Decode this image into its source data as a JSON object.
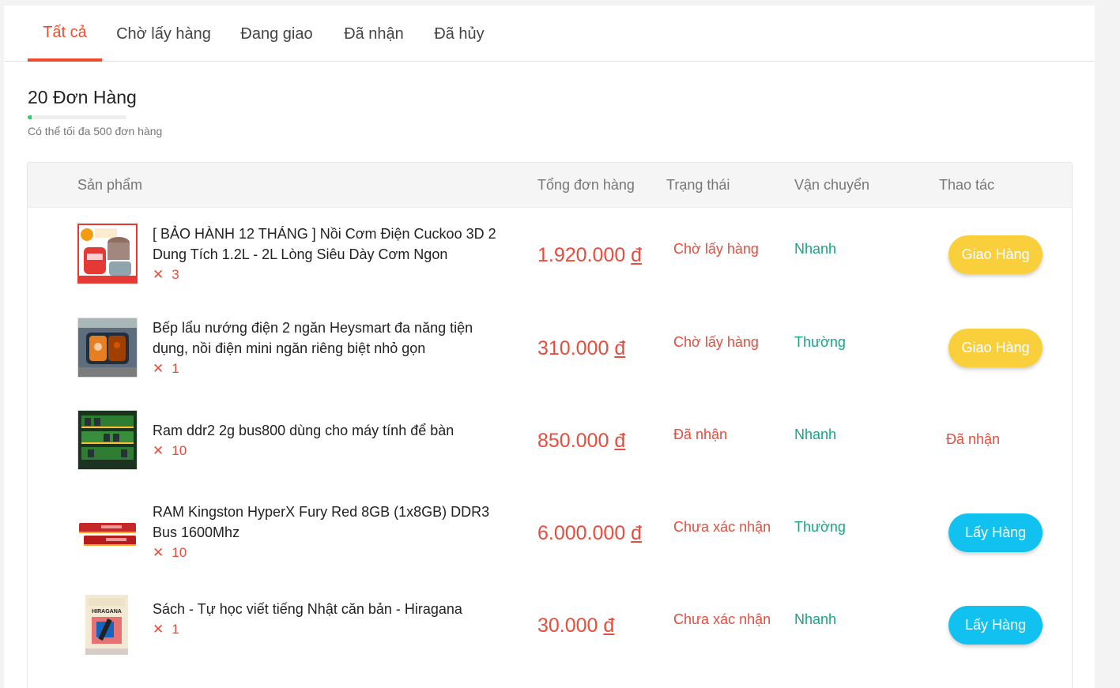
{
  "tabs": [
    {
      "label": "Tất cả"
    },
    {
      "label": "Chờ lấy hàng"
    },
    {
      "label": "Đang giao"
    },
    {
      "label": "Đã nhận"
    },
    {
      "label": "Đã hủy"
    }
  ],
  "summary": {
    "title": "20 Đơn Hàng",
    "subtitle": "Có thể tối đa 500 đơn hàng",
    "progress_fraction": 0.04
  },
  "table": {
    "headers": {
      "product": "Sản phẩm",
      "total": "Tổng đơn hàng",
      "status": "Trạng thái",
      "shipping": "Vận chuyển",
      "action": "Thao tác"
    },
    "rows": [
      {
        "name": "[ BẢO HÀNH 12 THÁNG ] Nồi Cơm Điện Cuckoo 3D 2 Dung Tích 1.2L - 2L Lòng Siêu Dày Cơm Ngon",
        "qty_icon": "✕",
        "qty": "3",
        "price": "1.920.000",
        "currency": "đ",
        "status": "Chờ lấy hàng",
        "shipping": "Nhanh",
        "action": "Giao Hàng",
        "thumb": "rice-cooker-image"
      },
      {
        "name": "Bếp lẩu nướng điện 2 ngăn Heysmart đa năng tiện dụng, nồi điện mini ngăn riêng biệt nhỏ gọn",
        "qty_icon": "✕",
        "qty": "1",
        "price": "310.000",
        "currency": "đ",
        "status": "Chờ lấy hàng",
        "shipping": "Thường",
        "action": "Giao Hàng",
        "thumb": "hotpot-grill-image"
      },
      {
        "name": "Ram ddr2 2g bus800 dùng cho máy tính để bàn",
        "qty_icon": "✕",
        "qty": "10",
        "price": "850.000",
        "currency": "đ",
        "status": "Đã nhận",
        "shipping": "Nhanh",
        "action": "Đã nhận",
        "thumb": "ram-ddr2-image"
      },
      {
        "name": "RAM Kingston HyperX Fury Red 8GB (1x8GB) DDR3 Bus 1600Mhz",
        "qty_icon": "✕",
        "qty": "10",
        "price": "6.000.000",
        "currency": "đ",
        "status": "Chưa xác nhận",
        "shipping": "Thường",
        "action": "Lấy Hàng",
        "thumb": "ram-hyperx-image"
      },
      {
        "name": "Sách - Tự học viết tiếng Nhật căn bản - Hiragana",
        "qty_icon": "✕",
        "qty": "1",
        "price": "30.000",
        "currency": "đ",
        "status": "Chưa xác nhận",
        "shipping": "Nhanh",
        "action": "Lấy Hàng",
        "thumb": "book-hiragana-image",
        "thumb_label": "HIRAGANA"
      }
    ]
  },
  "colors": {
    "accent": "#ee4d2d",
    "price": "#e74c3c",
    "shipping": "#17a589",
    "button_yellow": "#f9cf3c",
    "button_blue": "#11c2f0",
    "progress": "#2ecc71"
  }
}
